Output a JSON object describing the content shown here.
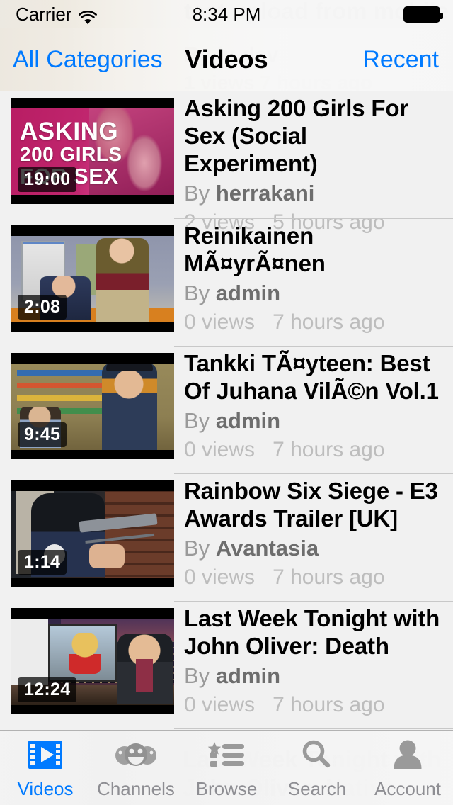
{
  "status_bar": {
    "carrier": "Carrier",
    "wifi_icon": "wifi-icon",
    "time": "8:34 PM",
    "battery_icon": "battery-full-icon"
  },
  "nav_bar": {
    "back_label": "All Categories",
    "title": "Videos",
    "right_label": "Recent"
  },
  "ghost_text": {
    "top_line1": "test upload from mobile",
    "top_line2": "By lu.dev",
    "top_line3": "1 views  7 hours ago",
    "bottom_line1": "Last Week Tonight with",
    "bottom_line2": "John Oliver: Native"
  },
  "colors": {
    "accent": "#007aff",
    "list_background": "#f1f1f1",
    "separator": "#c8c8c8",
    "title_text": "#000000",
    "author_text": "#9a9a9a",
    "author_name_text": "#6d6d6d",
    "meta_text": "#bdbdbd",
    "tab_inactive": "#8e8e93"
  },
  "list": {
    "by_prefix": "By",
    "items": [
      {
        "title": "Asking 200 Girls For Sex (Social Experiment)",
        "author": "herrakani",
        "views": "2 views",
        "age": "5 hours ago",
        "duration": "19:00",
        "thumb_caption_line1": "ASKING",
        "thumb_caption_line2": "200 GIRLS",
        "thumb_caption_line3": "FOR SEX"
      },
      {
        "title": "Reinikainen MÃ¤yrÃ¤nen",
        "author": "admin",
        "views": "0 views",
        "age": "7 hours ago",
        "duration": "2:08"
      },
      {
        "title": "Tankki TÃ¤yteen: Best Of Juhana VilÃ©n Vol.1",
        "author": "admin",
        "views": "0 views",
        "age": "7 hours ago",
        "duration": "9:45"
      },
      {
        "title": "Rainbow Six Siege - E3 Awards Trailer [UK]",
        "author": "Avantasia",
        "views": "0 views",
        "age": "7 hours ago",
        "duration": "1:14"
      },
      {
        "title": "Last Week Tonight with John Oliver: Death",
        "author": "admin",
        "views": "0 views",
        "age": "7 hours ago",
        "duration": "12:24"
      }
    ]
  },
  "tab_bar": {
    "tabs": [
      {
        "label": "Videos",
        "icon": "film-strip-play-icon",
        "active": true
      },
      {
        "label": "Channels",
        "icon": "three-smiley-faces-icon",
        "active": false
      },
      {
        "label": "Browse",
        "icon": "star-list-icon",
        "active": false
      },
      {
        "label": "Search",
        "icon": "magnifier-icon",
        "active": false
      },
      {
        "label": "Account",
        "icon": "person-icon",
        "active": false
      }
    ]
  }
}
